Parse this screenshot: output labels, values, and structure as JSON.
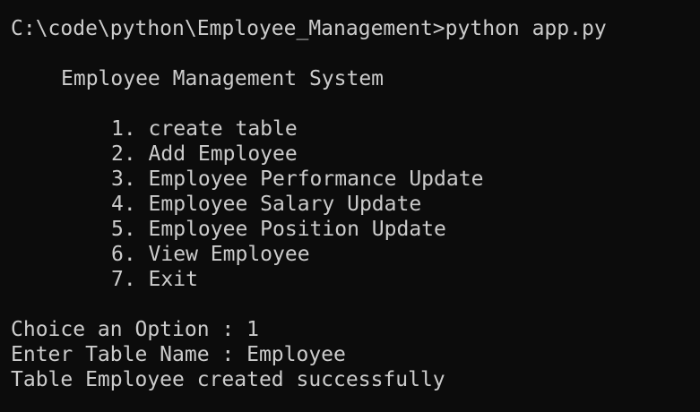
{
  "terminal": {
    "prompt_line": "C:\\code\\python\\Employee_Management>python app.py",
    "title": "Employee Management System",
    "menu": [
      "1. create table",
      "2. Add Employee",
      "3. Employee Performance Update",
      "4. Employee Salary Update",
      "5. Employee Position Update",
      "6. View Employee",
      "7. Exit"
    ],
    "output": [
      "Choice an Option : 1",
      "Enter Table Name : Employee",
      "Table Employee created successfully"
    ]
  },
  "colors": {
    "background": "#0c0c0c",
    "foreground": "#cccccc"
  }
}
